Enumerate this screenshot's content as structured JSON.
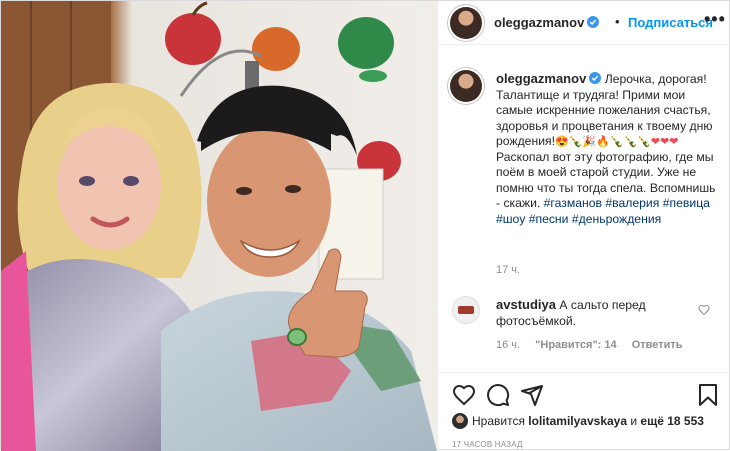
{
  "author": {
    "username": "oleggazmanov",
    "verified": true,
    "follow_label": "Подписаться",
    "more_label": "•••"
  },
  "caption": {
    "line1": "Лерочка, дорогая! Талантище и трудяга! Прими мои самые искренние пожелания счастья, здоровья и процветания к твоему дню рождения!",
    "emojis1": "😍🍾🎉🔥🍾🍾🍾",
    "line2": "Раскопал вот эту фотографию, где мы поём в моей старой студии. Уже не помню что ты тогда спела. Вспомнишь - скажи.",
    "hashtags": [
      "#газманов",
      "#валерия",
      "#певица",
      "#шоу",
      "#песни",
      "#деньрождения"
    ],
    "time": "17 ч."
  },
  "comment": {
    "username": "avstudiya",
    "text": "А сальто перед фотосъёмкой.",
    "time": "16 ч.",
    "likes": "\"Нравится\": 14",
    "reply": "Ответить"
  },
  "likes": {
    "prefix": "Нравится",
    "user": "lolitamilyavskaya",
    "middle": "и",
    "count": "ещё 18 553"
  },
  "timestamp": "17 часов назад",
  "icons": [
    "heart-icon",
    "comment-icon",
    "share-icon",
    "bookmark-icon",
    "verified-icon",
    "more-icon"
  ],
  "colors": {
    "accent": "#0095f6",
    "verified": "#3897f0",
    "hashtag": "#00376b",
    "heart": "#ed4956"
  }
}
